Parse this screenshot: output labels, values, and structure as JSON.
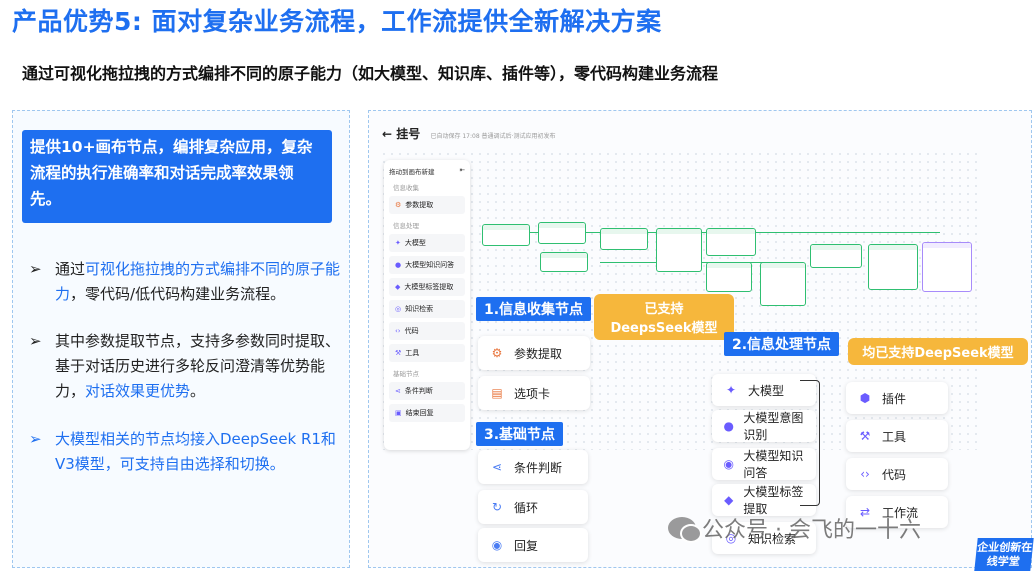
{
  "title": "产品优势5: 面对复杂业务流程，工作流提供全新解决方案",
  "subtitle": "通过可视化拖拉拽的方式编排不同的原子能力（如大模型、知识库、插件等），零代码构建业务流程",
  "left": {
    "highlight": "提供10+画布节点，编排复杂应用，复杂流程的执行准确率和对话完成率效果领先。",
    "bullet_arrow": "➢",
    "b1_pre": "通过",
    "b1_hl": "可视化拖拉拽的方式编排不同的原子能力",
    "b1_post": "，零代码/低代码构建业务流程。",
    "b2_pre": "其中参数提取节点，支持多参数同时提取、基于对话历史进行多轮反问澄清等优势能力，",
    "b2_hl": "对话效果更优势",
    "b2_post": "。",
    "b3": "大模型相关的节点均接入DeepSeek R1和V3模型，可支持自由选择和切换。"
  },
  "app": {
    "back_icon": "←",
    "title": "挂号",
    "meta": "已自动保存 17:08  普通调试后·测试应用初发布",
    "side_header": "拖动到画布新建",
    "groups": [
      "信息收集",
      "信息处理",
      "基础节点"
    ],
    "items_collect": [
      "参数提取"
    ],
    "items_process": [
      "大模型",
      "大模型知识问答",
      "大模型标签提取",
      "知识检索",
      "代码",
      "工具"
    ],
    "items_basic": [
      "条件判断",
      "结束回复"
    ]
  },
  "tags": {
    "collect": "1.信息收集节点",
    "process": "2.信息处理节点",
    "basic": "3.基础节点",
    "deepseek1": "已支持DeepsSeek模型",
    "deepseek2": "均已支持DeepSeek模型"
  },
  "cards": {
    "collect": [
      "参数提取",
      "选项卡"
    ],
    "basic": [
      "条件判断",
      "循环",
      "回复"
    ],
    "process": [
      "大模型",
      "大模型意图识别",
      "大模型知识问答",
      "大模型标签提取",
      "知识检索"
    ],
    "tools": [
      "插件",
      "工具",
      "代码",
      "工作流"
    ]
  },
  "watermark": "公众号 · 会飞的一十六",
  "badge": "企业创新在线学堂",
  "colors": {
    "accent": "#1e6ff0",
    "orange": "#f6b73c",
    "node_green": "#2fbf71"
  }
}
